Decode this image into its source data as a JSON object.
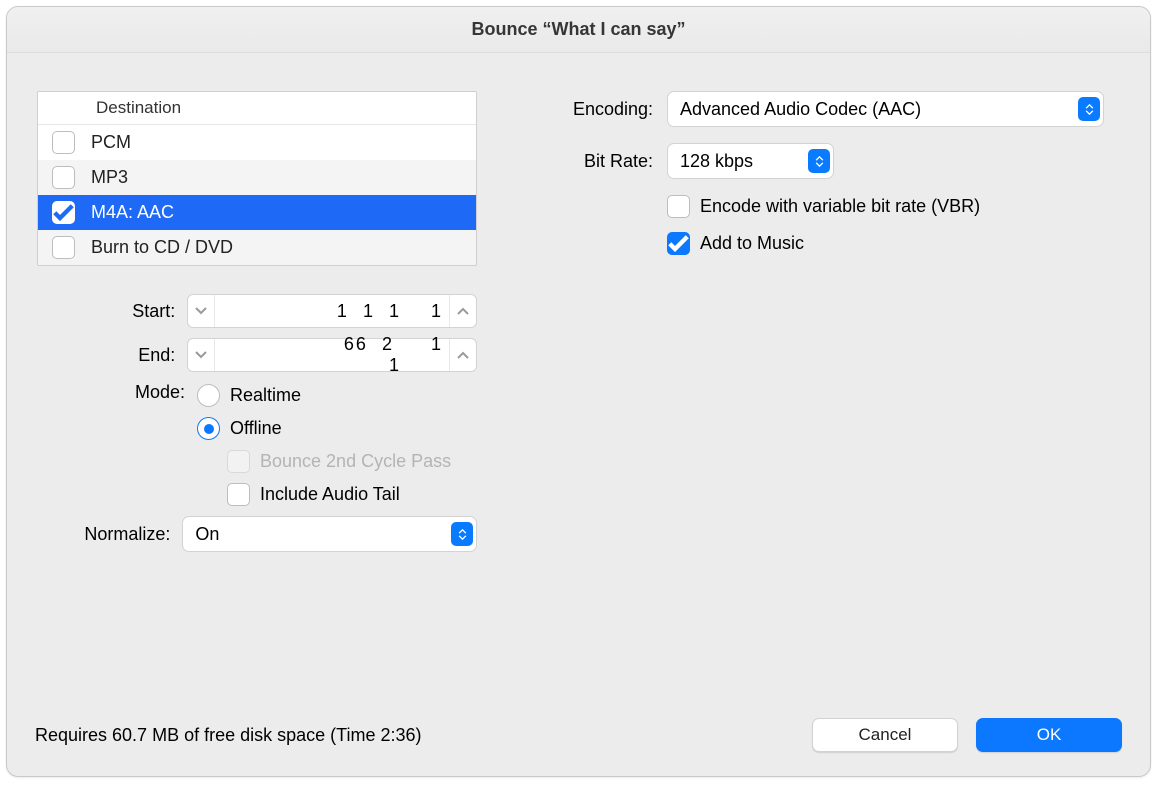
{
  "window": {
    "title": "Bounce “What I can say”"
  },
  "destination": {
    "header": "Destination",
    "rows": [
      {
        "label": "PCM",
        "checked": false,
        "selected": false
      },
      {
        "label": "MP3",
        "checked": false,
        "selected": false
      },
      {
        "label": "M4A: AAC",
        "checked": true,
        "selected": true
      },
      {
        "label": "Burn to CD / DVD",
        "checked": false,
        "selected": false
      }
    ]
  },
  "range": {
    "start_label": "Start:",
    "end_label": "End:",
    "start": {
      "a": "1",
      "b": "1",
      "c": "1",
      "d": "1"
    },
    "end": {
      "a": "66",
      "b": "2",
      "c": "1",
      "d": "1"
    }
  },
  "mode": {
    "label": "Mode:",
    "options": {
      "realtime": "Realtime",
      "offline": "Offline"
    },
    "selected": "offline",
    "bounce2nd_label": "Bounce 2nd Cycle Pass",
    "bounce2nd_enabled": false,
    "bounce2nd_checked": false,
    "include_tail_label": "Include Audio Tail",
    "include_tail_checked": false
  },
  "normalize": {
    "label": "Normalize:",
    "value": "On"
  },
  "right": {
    "encoding_label": "Encoding:",
    "encoding_value": "Advanced Audio Codec (AAC)",
    "bitrate_label": "Bit Rate:",
    "bitrate_value": "128 kbps",
    "vbr_label": "Encode with variable bit rate (VBR)",
    "vbr_checked": false,
    "addmusic_label": "Add to Music",
    "addmusic_checked": true
  },
  "footer": {
    "status": "Requires 60.7 MB of free disk space  (Time 2:36)",
    "cancel": "Cancel",
    "ok": "OK"
  }
}
